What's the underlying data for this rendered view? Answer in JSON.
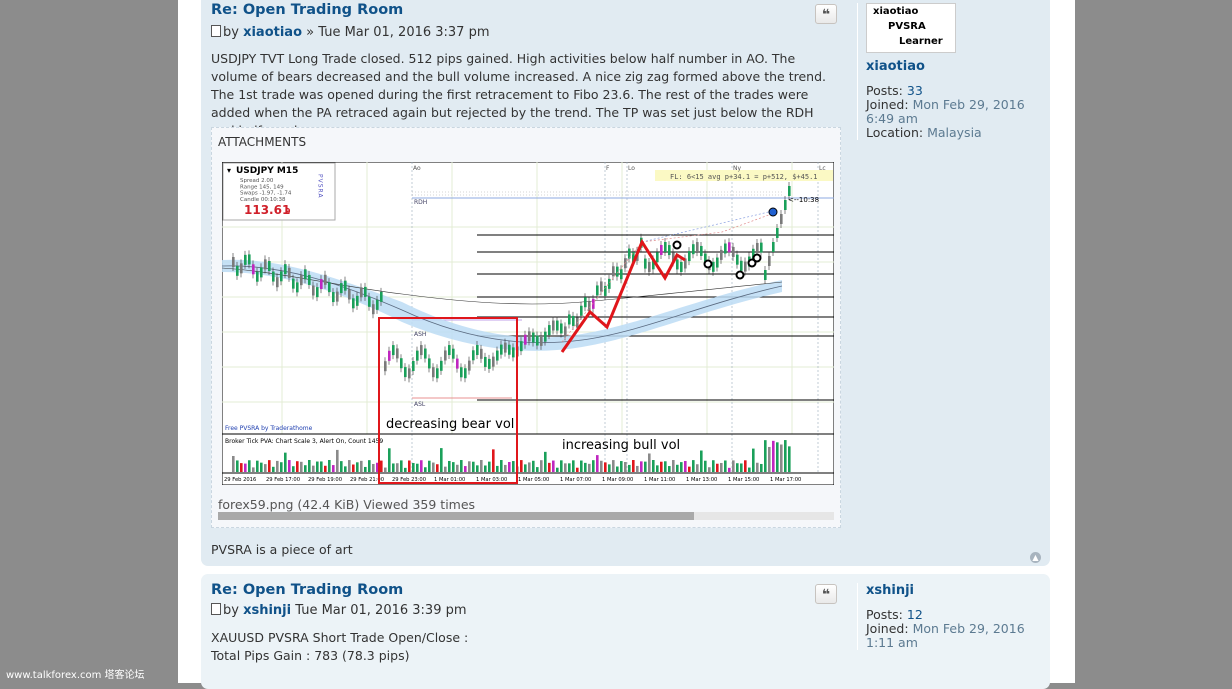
{
  "posts": [
    {
      "title": "Re: Open Trading Room",
      "by": "by",
      "author": "xiaotiao",
      "date": "» Tue Mar 01, 2016 3:37 pm",
      "quote_icon": "❝",
      "body": "USDJPY TVT Long Trade closed. 512 pips gained. High activities below half number in AO. The volume of bears decreased and the bull volume increased. A nice zig zag formed above the trend. The 1st trade was opened during the first retracement to Fibo 23.6. The rest of the trades were added when the PA retraced again but rejected by the trend. The TP was set just below the RDH and half number.",
      "attachments_label": "ATTACHMENTS",
      "attachment_caption": "forex59.png (42.4 KiB) Viewed 359 times",
      "footer_text": "PVSRA is a piece of art",
      "profile": {
        "avatar_lines": [
          "xiaotiao",
          "PVSRA",
          "Learner"
        ],
        "name": "xiaotiao",
        "posts_label": "Posts:",
        "posts": "33",
        "joined_label": "Joined:",
        "joined": "Mon Feb 29, 2016 6:49 am",
        "location_label": "Location:",
        "location": "Malaysia"
      }
    },
    {
      "title": "Re: Open Trading Room",
      "by": "by",
      "author": "xshinji",
      "date": "Tue Mar 01, 2016 3:39 pm",
      "quote_icon": "❝",
      "body_line1": "XAUUSD PVSRA Short Trade Open/Close :",
      "body_line2": "Total Pips Gain : 783 (78.3 pips)",
      "profile": {
        "name": "xshinji",
        "posts_label": "Posts:",
        "posts": "12",
        "joined_label": "Joined:",
        "joined": "Mon Feb 29, 2016 1:11 am"
      }
    }
  ],
  "chart": {
    "symbol": "USDJPY  M15",
    "info_lines": [
      "Spread  2.00",
      "Range  145, 149",
      "Swaps  -1.97, -1.74",
      "Candle  00:10:38"
    ],
    "price": "113.61",
    "price_digit": "9",
    "pvsra_vertical": "PVSRA",
    "top_banner": "FL: 6<15 avg p+34.1 = p+512, $+45.1",
    "session_labels": [
      "Ao",
      "F",
      "Lo",
      "Ny",
      "Lc"
    ],
    "level_labels": [
      "RDH",
      "ASH",
      "ASL"
    ],
    "timer": "<--10:38",
    "credit": "Free PVSRA by Traderathome",
    "volume_header": "Broker Tick PVA:    Chart Scale  3,  Alert On,   Count  1459",
    "annotation_bear": "decreasing bear vol",
    "annotation_bull": "increasing bull vol",
    "time_labels": [
      "29 Feb 2016",
      "29 Feb 17:00",
      "29 Feb 19:00",
      "29 Feb 21:00",
      "29 Feb 23:00",
      "1 Mar 01:00",
      "1 Mar 03:00",
      "1 Mar 05:00",
      "1 Mar 07:00",
      "1 Mar 09:00",
      "1 Mar 11:00",
      "1 Mar 13:00",
      "1 Mar 15:00",
      "1 Mar 17:00"
    ],
    "colors": {
      "bull": "#1aa05a",
      "bear": "#7a7a7a",
      "climax": "#c026c0",
      "red": "#e0161b",
      "band": "#bcdcf4"
    }
  },
  "footer_watermark": "www.talkforex.com 塔客论坛"
}
